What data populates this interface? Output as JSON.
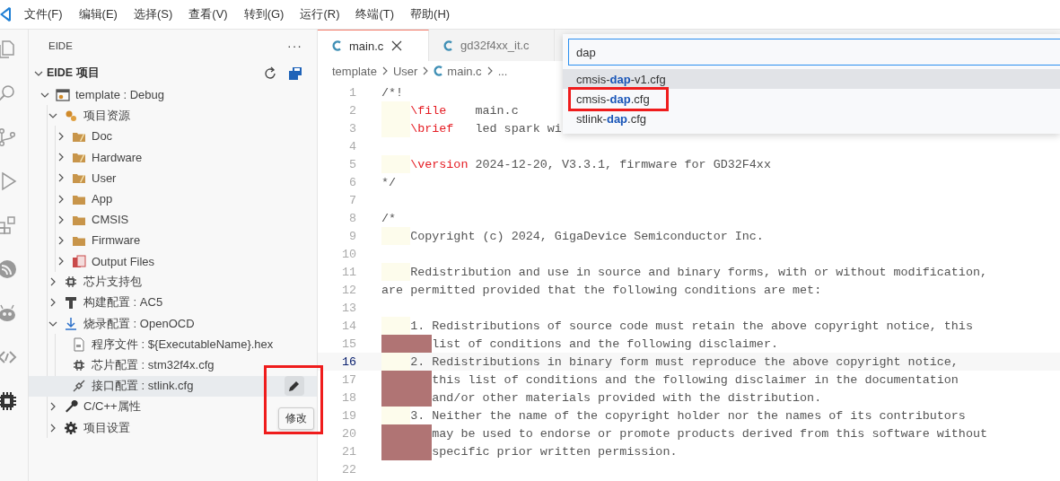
{
  "menu_bar": {
    "items": [
      "文件(F)",
      "编辑(E)",
      "选择(S)",
      "查看(V)",
      "转到(G)",
      "运行(R)",
      "终端(T)",
      "帮助(H)"
    ]
  },
  "activity_bar": {
    "items": [
      {
        "kind": "files",
        "selected": false
      },
      {
        "kind": "search",
        "selected": false
      },
      {
        "kind": "source-control",
        "selected": false
      },
      {
        "kind": "run",
        "selected": false
      },
      {
        "kind": "extensions",
        "selected": false
      },
      {
        "kind": "signal",
        "selected": false
      },
      {
        "kind": "robot",
        "selected": false
      },
      {
        "kind": "arrows",
        "selected": false
      },
      {
        "kind": "chip",
        "selected": true
      }
    ]
  },
  "sidebar": {
    "title": "EIDE",
    "more": "···",
    "section": {
      "title": "EIDE 项目",
      "expanded": true
    },
    "tree": [
      {
        "label": "template : Debug",
        "kind": "project",
        "expanded": true,
        "hovered": false,
        "children": [
          {
            "label": "项目资源",
            "kind": "resources",
            "expanded": true,
            "hovered": false,
            "children": [
              {
                "label": "Doc",
                "kind": "folder-pen",
                "expanded": false,
                "hovered": false
              },
              {
                "label": "Hardware",
                "kind": "folder-pen",
                "expanded": false,
                "hovered": false
              },
              {
                "label": "User",
                "kind": "folder-pen",
                "expanded": false,
                "hovered": false
              },
              {
                "label": "App",
                "kind": "folder",
                "expanded": false,
                "hovered": false
              },
              {
                "label": "CMSIS",
                "kind": "folder",
                "expanded": false,
                "hovered": false
              },
              {
                "label": "Firmware",
                "kind": "folder",
                "expanded": false,
                "hovered": false
              },
              {
                "label": "Output Files",
                "kind": "output",
                "expanded": false,
                "hovered": false
              }
            ]
          },
          {
            "label": "芯片支持包",
            "kind": "chip",
            "expanded": false,
            "hovered": false
          },
          {
            "label": "构建配置 : AC5",
            "kind": "hammer",
            "expanded": false,
            "hovered": false
          },
          {
            "label": "烧录配置 : OpenOCD",
            "kind": "download",
            "expanded": true,
            "hovered": false,
            "children": [
              {
                "label": "程序文件 : ${ExecutableName}.hex",
                "kind": "file",
                "hovered": false
              },
              {
                "label": "芯片配置 : stm32f4x.cfg",
                "kind": "chip",
                "hovered": false
              },
              {
                "label": "接口配置 : stlink.cfg",
                "kind": "plug",
                "hovered": true,
                "action": {
                  "tooltip": "修改",
                  "annotated": true
                }
              }
            ]
          },
          {
            "label": "C/C++属性",
            "kind": "wrench",
            "expanded": false,
            "hovered": false
          },
          {
            "label": "项目设置",
            "kind": "gear",
            "expanded": false,
            "hovered": false
          }
        ]
      }
    ]
  },
  "editor": {
    "tabs": [
      {
        "label": "main.c",
        "selected": true
      },
      {
        "label": "gd32f4xx_it.c",
        "selected": false
      }
    ],
    "breadcrumb": [
      {
        "label": "template",
        "kind": "text"
      },
      {
        "label": "User",
        "kind": "text"
      },
      {
        "label": "main.c",
        "kind": "c-file"
      },
      {
        "label": "...",
        "kind": "text"
      }
    ],
    "lines": [
      {
        "number": "1",
        "kind": "plain",
        "current": false,
        "text": "/*!"
      },
      {
        "number": "2",
        "kind": "indented",
        "current": false,
        "keyword": "\\file",
        "text": "    main.c"
      },
      {
        "number": "3",
        "kind": "indented",
        "current": false,
        "keyword": "\\brief",
        "text": "   led spark wi"
      },
      {
        "number": "4",
        "kind": "plain",
        "current": false
      },
      {
        "number": "5",
        "kind": "indented",
        "current": false,
        "keyword": "\\version",
        "text": " 2024-12-20, V3.3.1, firmware for GD32F4xx"
      },
      {
        "number": "6",
        "kind": "plain",
        "current": false,
        "text": "*/"
      },
      {
        "number": "7",
        "kind": "plain",
        "current": false
      },
      {
        "number": "8",
        "kind": "plain",
        "current": false,
        "text": "/*"
      },
      {
        "number": "9",
        "kind": "indented",
        "current": false,
        "text": "Copyright (c) 2024, GigaDevice Semiconductor Inc."
      },
      {
        "number": "10",
        "kind": "plain",
        "current": false
      },
      {
        "number": "11",
        "kind": "indented",
        "current": false,
        "text": "Redistribution and use in source and binary forms, with or without modification,"
      },
      {
        "number": "12",
        "kind": "plain",
        "current": false,
        "text": "are permitted provided that the following conditions are met:"
      },
      {
        "number": "13",
        "kind": "plain",
        "current": false
      },
      {
        "number": "14",
        "kind": "indented",
        "current": false,
        "text": "1. Redistributions of source code must retain the above copyright notice, this"
      },
      {
        "number": "15",
        "kind": "misindented",
        "current": false,
        "text": "list of conditions and the following disclaimer."
      },
      {
        "number": "16",
        "kind": "indented",
        "current": true,
        "text": "2. Redistributions in binary form must reproduce the above copyright notice,"
      },
      {
        "number": "17",
        "kind": "misindented",
        "current": false,
        "text": "this list of conditions and the following disclaimer in the documentation"
      },
      {
        "number": "18",
        "kind": "misindented",
        "current": false,
        "text": "and/or other materials provided with the distribution."
      },
      {
        "number": "19",
        "kind": "indented",
        "current": false,
        "text": "3. Neither the name of the copyright holder nor the names of its contributors"
      },
      {
        "number": "20",
        "kind": "misindented",
        "current": false,
        "text": "may be used to endorse or promote products derived from this software without"
      },
      {
        "number": "21",
        "kind": "misindented",
        "current": false,
        "text": "specific prior written permission."
      },
      {
        "number": "22",
        "kind": "plain",
        "current": false
      }
    ]
  },
  "quick_pick": {
    "value": "dap",
    "items": [
      {
        "label": "cmsis-**dap**-v1.cfg",
        "selected": true,
        "annotated": false
      },
      {
        "label": "cmsis-**dap**.cfg",
        "selected": false,
        "annotated": true
      },
      {
        "label": "stlink-**dap**.cfg",
        "selected": false,
        "annotated": false
      }
    ]
  }
}
